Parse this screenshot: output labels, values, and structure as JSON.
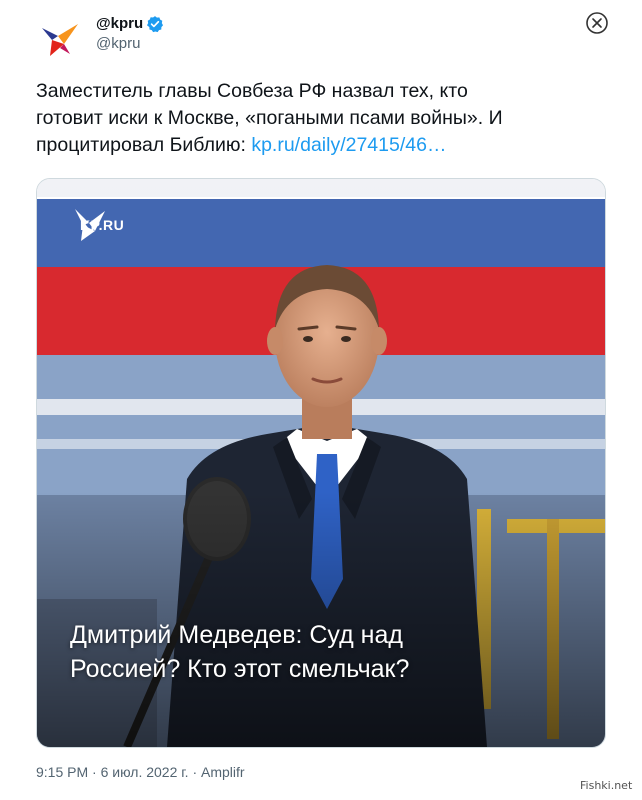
{
  "author": {
    "display_name": "@kpru",
    "handle": "@kpru",
    "verified": true
  },
  "tweet": {
    "text_before_link": "Заместитель главы Совбеза РФ назвал тех, кто\nготовит иски к Москве, «погаными псами войны». И\nпроцитировал Библию: ",
    "link": "kp.ru/daily/27415/46…"
  },
  "card": {
    "logo_text": "KP.RU",
    "headline": "Дмитрий Медведев: Суд над\nРоссией? Кто этот смельчак?"
  },
  "meta": {
    "time": "9:15 PM",
    "separator1": " · ",
    "date": "6 июл. 2022 г.",
    "separator2": " · ",
    "source": "Amplifr"
  },
  "watermark": "Fishki.net",
  "colors": {
    "link": "#1d9bf0",
    "verified": "#1d9bf0",
    "logo_red": "#e2231a",
    "logo_orange": "#f7941d",
    "logo_blue": "#2b3990"
  }
}
